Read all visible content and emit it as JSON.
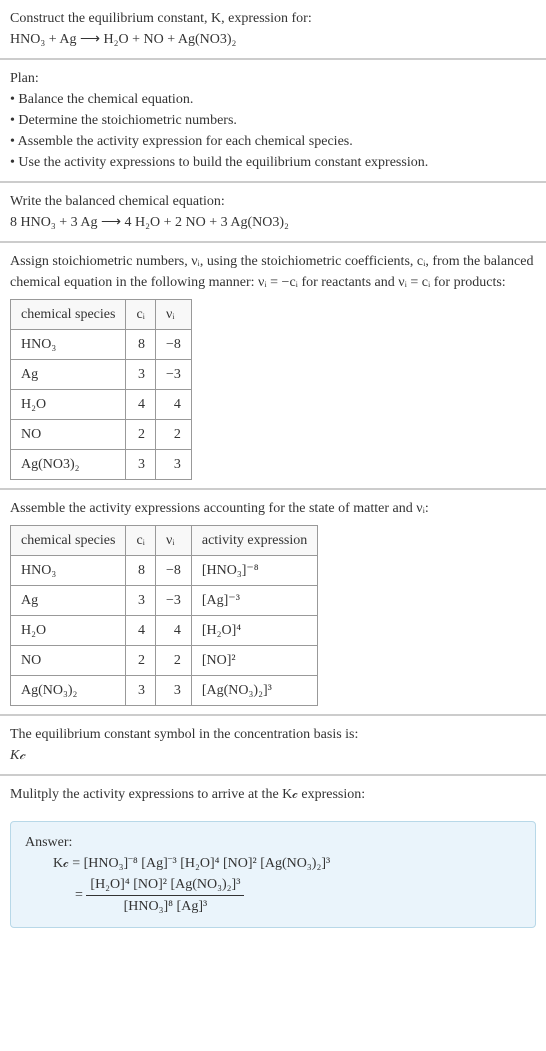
{
  "prompt": {
    "line1": "Construct the equilibrium constant, K, expression for:",
    "line2": "HNO₃ + Ag ⟶ H₂O + NO + Ag(NO3)₂"
  },
  "plan": {
    "heading": "Plan:",
    "b1": "• Balance the chemical equation.",
    "b2": "• Determine the stoichiometric numbers.",
    "b3": "• Assemble the activity expression for each chemical species.",
    "b4": "• Use the activity expressions to build the equilibrium constant expression."
  },
  "balanced": {
    "heading": "Write the balanced chemical equation:",
    "eq": "8 HNO₃ + 3 Ag ⟶ 4 H₂O + 2 NO + 3 Ag(NO3)₂"
  },
  "assign": {
    "intro": "Assign stoichiometric numbers, νᵢ, using the stoichiometric coefficients, cᵢ, from the balanced chemical equation in the following manner: νᵢ = −cᵢ for reactants and νᵢ = cᵢ for products:",
    "h0": "chemical species",
    "h1": "cᵢ",
    "h2": "νᵢ",
    "rows": [
      {
        "s": "HNO₃",
        "c": "8",
        "v": "−8"
      },
      {
        "s": "Ag",
        "c": "3",
        "v": "−3"
      },
      {
        "s": "H₂O",
        "c": "4",
        "v": "4"
      },
      {
        "s": "NO",
        "c": "2",
        "v": "2"
      },
      {
        "s": "Ag(NO3)₂",
        "c": "3",
        "v": "3"
      }
    ]
  },
  "activity": {
    "intro": "Assemble the activity expressions accounting for the state of matter and νᵢ:",
    "h0": "chemical species",
    "h1": "cᵢ",
    "h2": "νᵢ",
    "h3": "activity expression",
    "rows": [
      {
        "s": "HNO₃",
        "c": "8",
        "v": "−8",
        "a": "[HNO₃]⁻⁸"
      },
      {
        "s": "Ag",
        "c": "3",
        "v": "−3",
        "a": "[Ag]⁻³"
      },
      {
        "s": "H₂O",
        "c": "4",
        "v": "4",
        "a": "[H₂O]⁴"
      },
      {
        "s": "NO",
        "c": "2",
        "v": "2",
        "a": "[NO]²"
      },
      {
        "s": "Ag(NO₃)₂",
        "c": "3",
        "v": "3",
        "a": "[Ag(NO₃)₂]³"
      }
    ]
  },
  "symbol": {
    "line1": "The equilibrium constant symbol in the concentration basis is:",
    "line2": "K𝒸"
  },
  "mult": {
    "line": "Mulitply the activity expressions to arrive at the K𝒸 expression:"
  },
  "answer": {
    "label": "Answer:",
    "eq1": "K𝒸 = [HNO₃]⁻⁸ [Ag]⁻³ [H₂O]⁴ [NO]² [Ag(NO₃)₂]³",
    "eq2_lead": "= ",
    "eq2_num": "[H₂O]⁴ [NO]² [Ag(NO₃)₂]³",
    "eq2_den": "[HNO₃]⁸ [Ag]³"
  }
}
